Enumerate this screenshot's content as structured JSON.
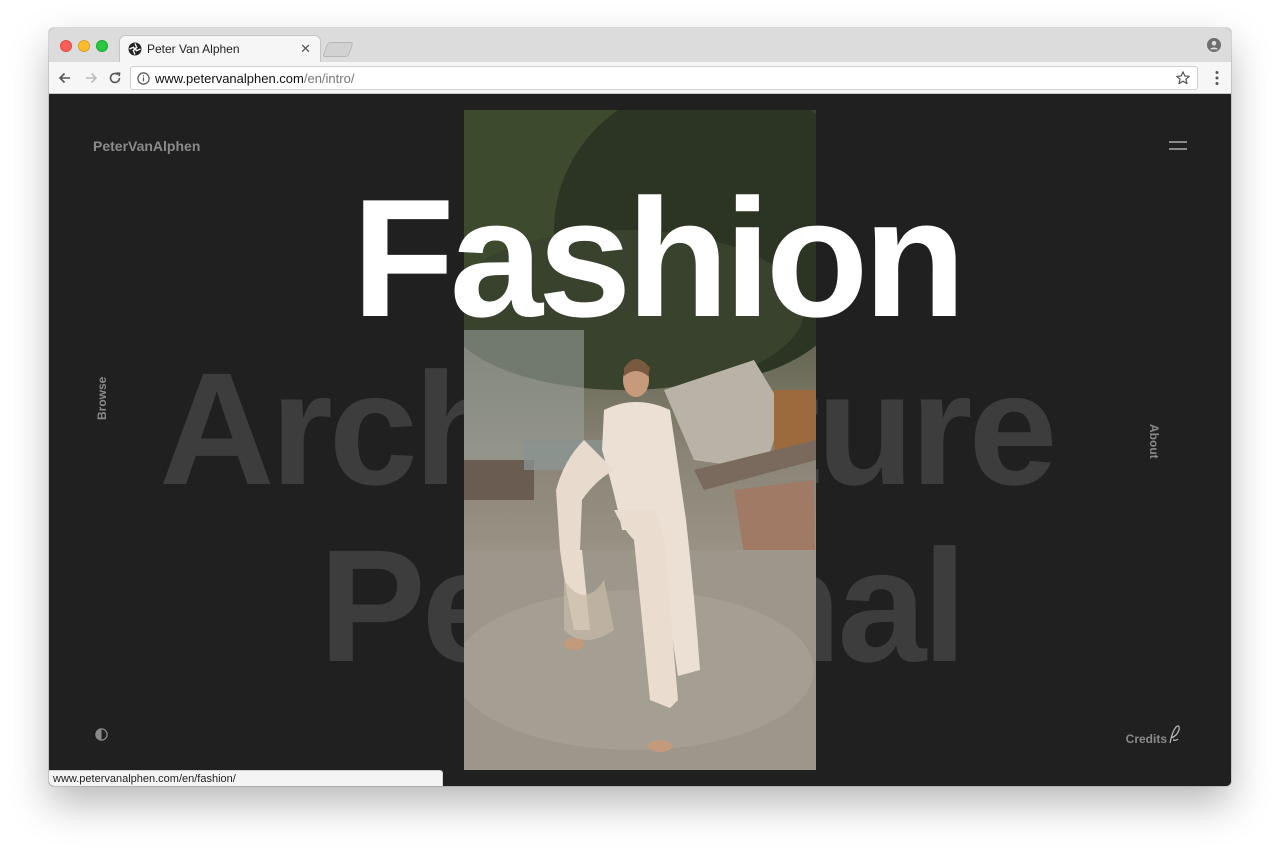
{
  "browser": {
    "tab": {
      "title": "Peter Van Alphen"
    },
    "address": {
      "host": "www.petervanalphen.com",
      "path": "/en/intro/"
    }
  },
  "site": {
    "brand": "PeterVanAlphen",
    "hero_word": "Fashion",
    "background_words": [
      "Architecture",
      "Personal"
    ],
    "side_left": "Browse",
    "side_right": "About",
    "credits": "Credits"
  },
  "status_bar": {
    "url": "www.petervanalphen.com/en/fashion/"
  },
  "colors": {
    "page_bg": "#202020",
    "muted_text": "#8a8a8a",
    "ghost_text": "#3d3d3d",
    "hero_text": "#ffffff"
  },
  "icons": [
    "aperture-favicon-icon",
    "close-icon",
    "profile-icon",
    "back-icon",
    "forward-icon",
    "reload-icon",
    "info-icon",
    "star-icon",
    "kebab-menu-icon",
    "hamburger-menu-icon",
    "contrast-icon",
    "signature-icon"
  ]
}
